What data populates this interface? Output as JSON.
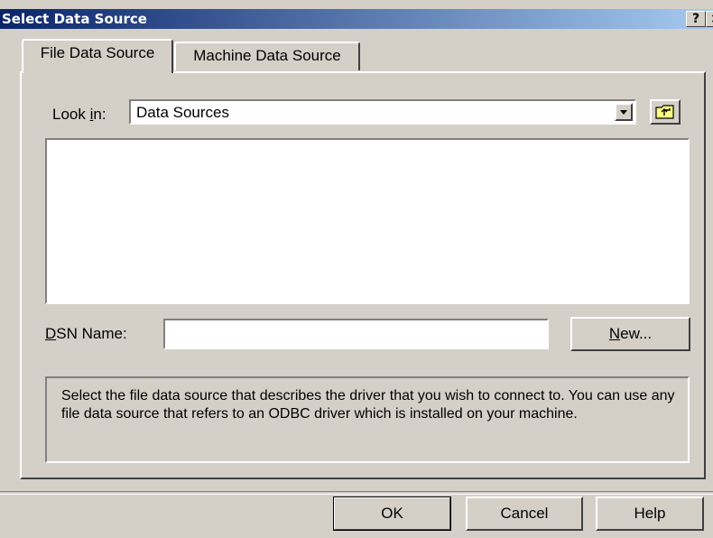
{
  "window": {
    "title": "Select Data Source",
    "help_button": "?",
    "close_button": "×"
  },
  "tabs": [
    {
      "label": "File Data Source",
      "active": true
    },
    {
      "label": "Machine Data Source",
      "active": false
    }
  ],
  "look_in": {
    "label_prefix": "Look ",
    "label_accel": "i",
    "label_suffix": "n:",
    "value": "Data Sources"
  },
  "dsn": {
    "label_accel": "D",
    "label_rest": "SN Name:",
    "value": ""
  },
  "new_button": {
    "accel": "N",
    "rest": "ew..."
  },
  "info_text": "Select the file data source that describes the driver that you wish to connect to. You can use any file data source that refers to an ODBC driver which is installed on your machine.",
  "footer_buttons": {
    "ok": "OK",
    "cancel": "Cancel",
    "help": "Help"
  },
  "icons": {
    "up_folder": "up-one-level-icon",
    "dropdown": "dropdown-arrow-icon"
  },
  "colors": {
    "title_start": "#0a246a",
    "title_end": "#a6caf0",
    "face": "#d4d0c8"
  }
}
